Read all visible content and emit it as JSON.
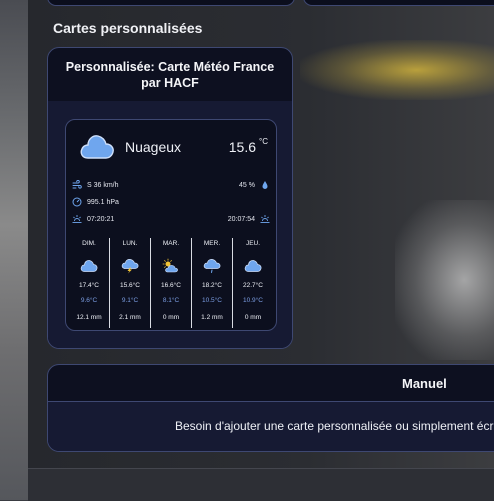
{
  "section": {
    "title": "Cartes personnalisées"
  },
  "weather_card": {
    "title": "Personnalisée: Carte Météo France par HACF",
    "condition": "Nuageux",
    "condition_icon": "cloudy-icon",
    "temperature": "15.6",
    "temperature_unit": "°C",
    "wind": "S 36 km/h",
    "humidity": "45 %",
    "pressure": "995.1 hPa",
    "sunrise": "07:20:21",
    "sunset": "20:07:54",
    "forecast": [
      {
        "day": "DIM.",
        "icon": "cloudy-icon",
        "high": "17.4°C",
        "low": "9.6°C",
        "precip": "12.1 mm"
      },
      {
        "day": "LUN.",
        "icon": "thunderstorm-icon",
        "high": "15.6°C",
        "low": "9.1°C",
        "precip": "2.1 mm"
      },
      {
        "day": "MAR.",
        "icon": "partly-cloudy-icon",
        "high": "16.6°C",
        "low": "8.1°C",
        "precip": "0 mm"
      },
      {
        "day": "MER.",
        "icon": "rain-icon",
        "high": "18.2°C",
        "low": "10.5°C",
        "precip": "1.2 mm"
      },
      {
        "day": "JEU.",
        "icon": "cloudy-icon",
        "high": "22.7°C",
        "low": "10.9°C",
        "precip": "0 mm"
      }
    ]
  },
  "manual_card": {
    "title": "Manuel",
    "text": "Besoin d'ajouter une carte personnalisée ou simplement écr"
  },
  "colors": {
    "card_background": "#0d1020",
    "card_border": "#3e4872",
    "low_temp": "#7b9de2",
    "cloud": "#6fa6ee"
  }
}
